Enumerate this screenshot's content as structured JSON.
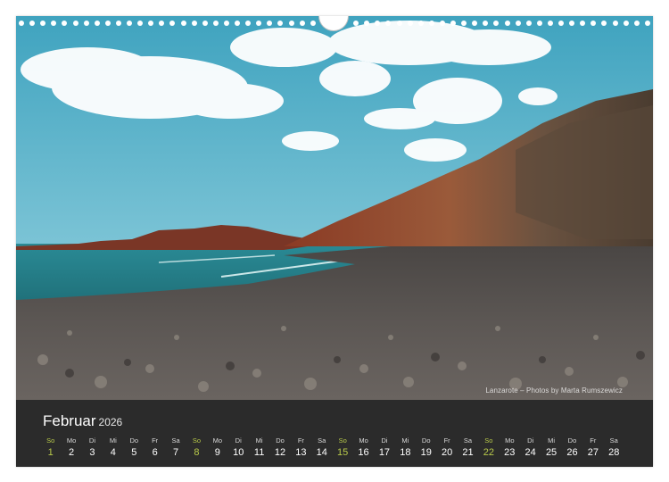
{
  "calendar": {
    "month": "Februar",
    "year": "2026",
    "sunday_color": "#b8c94a",
    "days": [
      {
        "wd": "So",
        "n": "1",
        "sunday": true
      },
      {
        "wd": "Mo",
        "n": "2"
      },
      {
        "wd": "Di",
        "n": "3"
      },
      {
        "wd": "Mi",
        "n": "4"
      },
      {
        "wd": "Do",
        "n": "5"
      },
      {
        "wd": "Fr",
        "n": "6"
      },
      {
        "wd": "Sa",
        "n": "7"
      },
      {
        "wd": "So",
        "n": "8",
        "sunday": true
      },
      {
        "wd": "Mo",
        "n": "9"
      },
      {
        "wd": "Di",
        "n": "10"
      },
      {
        "wd": "Mi",
        "n": "11"
      },
      {
        "wd": "Do",
        "n": "12"
      },
      {
        "wd": "Fr",
        "n": "13"
      },
      {
        "wd": "Sa",
        "n": "14"
      },
      {
        "wd": "So",
        "n": "15",
        "sunday": true
      },
      {
        "wd": "Mo",
        "n": "16"
      },
      {
        "wd": "Di",
        "n": "17"
      },
      {
        "wd": "Mi",
        "n": "18"
      },
      {
        "wd": "Do",
        "n": "19"
      },
      {
        "wd": "Fr",
        "n": "20"
      },
      {
        "wd": "Sa",
        "n": "21"
      },
      {
        "wd": "So",
        "n": "22",
        "sunday": true
      },
      {
        "wd": "Mo",
        "n": "23"
      },
      {
        "wd": "Di",
        "n": "24"
      },
      {
        "wd": "Mi",
        "n": "25"
      },
      {
        "wd": "Do",
        "n": "26"
      },
      {
        "wd": "Fr",
        "n": "27"
      },
      {
        "wd": "Sa",
        "n": "28"
      }
    ]
  },
  "photo": {
    "credit": "Lanzarote – Photos by Marta Rumszewicz"
  }
}
